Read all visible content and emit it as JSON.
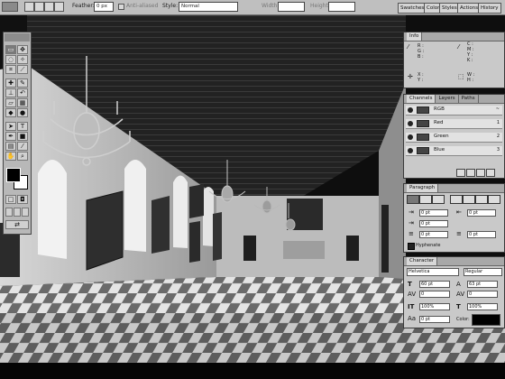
{
  "options_bar": {
    "feather_label": "Feather:",
    "feather_value": "0 px",
    "antialiased_label": "Anti-aliased",
    "style_label": "Style:",
    "style_value": "Normal",
    "width_label": "Width:",
    "height_label": "Height:",
    "palette_tabs": [
      "Swatches",
      "Color",
      "Styles",
      "Actions",
      "History"
    ]
  },
  "toolbox": {
    "tools": [
      "marquee",
      "move",
      "lasso",
      "magic-wand",
      "crop",
      "slice",
      "healing",
      "brush",
      "stamp",
      "history-brush",
      "eraser",
      "gradient",
      "blur",
      "dodge",
      "path-select",
      "type",
      "pen",
      "shape",
      "notes",
      "eyedropper",
      "hand",
      "zoom"
    ],
    "foreground_color": "#000000",
    "background_color": "#ffffff"
  },
  "info_panel": {
    "title": "Info",
    "labels_left": [
      "R :",
      "G :",
      "B :"
    ],
    "labels_right": [
      "C :",
      "M :",
      "Y :",
      "K :"
    ],
    "xy_left": [
      "X :",
      "Y :"
    ],
    "xy_right": [
      "W :",
      "H :"
    ]
  },
  "channels_panel": {
    "tabs": [
      "Channels",
      "Layers",
      "Paths"
    ],
    "channels": [
      {
        "name": "RGB",
        "key": "~"
      },
      {
        "name": "Red",
        "key": "1"
      },
      {
        "name": "Green",
        "key": "2"
      },
      {
        "name": "Blue",
        "key": "3"
      }
    ]
  },
  "paragraph_panel": {
    "title": "Paragraph",
    "indent_left": "0 pt",
    "indent_right": "0 pt",
    "indent_first": "0 pt",
    "space_before": "0 pt",
    "space_after": "0 pt",
    "hyphenate_label": "Hyphenate"
  },
  "character_panel": {
    "title": "Character",
    "font_family": "Helvetica",
    "font_style": "Regular",
    "font_size": "60 pt",
    "leading": "63 pt",
    "kerning": "0",
    "tracking": "0",
    "vertical_scale": "100%",
    "horizontal_scale": "100%",
    "baseline_shift": "0 pt",
    "color_label": "Color:",
    "text_color": "#000000"
  }
}
